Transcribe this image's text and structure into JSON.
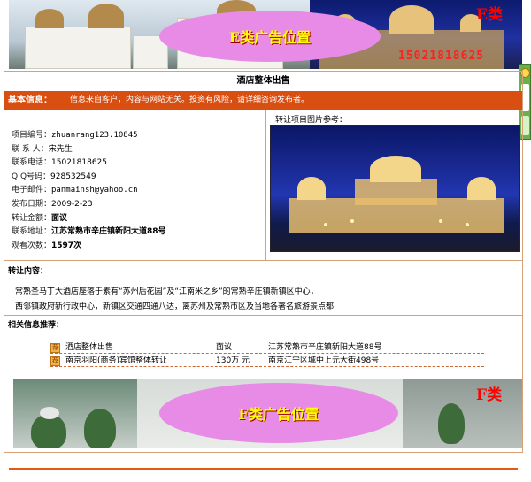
{
  "banners": {
    "top": {
      "ad_text": "E类广告位置",
      "corner_tag": "E类",
      "phone": "15021818625"
    },
    "bottom": {
      "ad_text": "F类广告位置",
      "corner_tag": "F类"
    }
  },
  "page": {
    "title": "酒店整体出售"
  },
  "info_bar": {
    "label": "基本信息：",
    "note": "信息来自客户，内容与网站无关。投资有风险，请详细咨询发布者。"
  },
  "details": {
    "rows": [
      {
        "key": "项目编号：",
        "value": "zhuanrang123.10845",
        "bold": false
      },
      {
        "key": "联 系 人：",
        "value": "宋先生",
        "bold": false
      },
      {
        "key": "联系电话：",
        "value": "15021818625",
        "bold": false
      },
      {
        "key": "Q Q号码：",
        "value": "928532549",
        "bold": false
      },
      {
        "key": "电子邮件：",
        "value": "panmainsh@yahoo.cn",
        "bold": false
      },
      {
        "key": "发布日期：",
        "value": "2009-2-23",
        "bold": false
      },
      {
        "key": "转让金额：",
        "value": "面议",
        "bold": true
      },
      {
        "key": "联系地址：",
        "value": "江苏常熟市辛庄镇新阳大道88号",
        "bold": true
      },
      {
        "key": "观看次数：",
        "value": "1597次",
        "bold": false
      }
    ]
  },
  "photo": {
    "label": "转让项目图片参考："
  },
  "transfer": {
    "title": "转让内容：",
    "line1": "常熟圣马丁大酒店座落于素有“苏州后花园”及“江南米之乡”的常熟辛庄镇新镇区中心，",
    "line2": "西邻镇政府新行政中心，新镇区交通四通八达，离苏州及常熟市区及当地各著名旅游景点都"
  },
  "related": {
    "title": "相关信息推荐：",
    "icon_glyph": "荐",
    "items": [
      {
        "name": "酒店整体出售",
        "price": "面议",
        "location": "江苏常熟市辛庄镇新阳大道88号"
      },
      {
        "name": "南京羽阳(商务)宾馆整体转让",
        "price": "130万 元",
        "location": "南京江宁区城中上元大街498号"
      }
    ]
  },
  "colors": {
    "accent": "#d94f12",
    "border": "#d6a07a",
    "ad_bg": "#e88be6",
    "ad_text": "#ffff00"
  }
}
